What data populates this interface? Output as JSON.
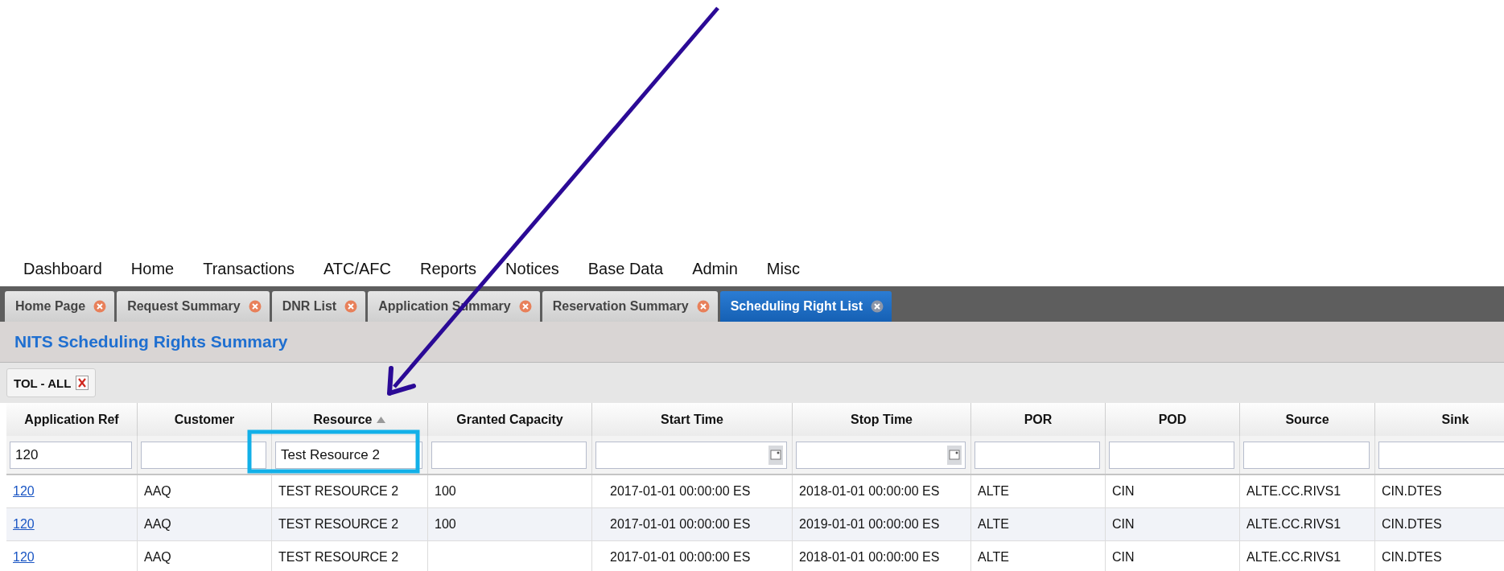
{
  "menu": [
    "Dashboard",
    "Home",
    "Transactions",
    "ATC/AFC",
    "Reports",
    "Notices",
    "Base Data",
    "Admin",
    "Misc"
  ],
  "tabs": [
    {
      "label": "Home Page",
      "selected": false
    },
    {
      "label": "Request Summary",
      "selected": false
    },
    {
      "label": "DNR List",
      "selected": false
    },
    {
      "label": "Application Summary",
      "selected": false
    },
    {
      "label": "Reservation Summary",
      "selected": false
    },
    {
      "label": "Scheduling Right List",
      "selected": true
    }
  ],
  "page_title": "NITS Scheduling Rights Summary",
  "filter_chip": {
    "label": "TOL - ALL"
  },
  "table": {
    "columns": [
      {
        "label": "Application Ref",
        "sorted": false
      },
      {
        "label": "Customer",
        "sorted": false
      },
      {
        "label": "Resource",
        "sorted": true
      },
      {
        "label": "Granted Capacity",
        "sorted": false
      },
      {
        "label": "Start Time",
        "sorted": false
      },
      {
        "label": "Stop Time",
        "sorted": false
      },
      {
        "label": "POR",
        "sorted": false
      },
      {
        "label": "POD",
        "sorted": false
      },
      {
        "label": "Source",
        "sorted": false
      },
      {
        "label": "Sink",
        "sorted": false
      }
    ],
    "filters": [
      {
        "kind": "text",
        "value": "120"
      },
      {
        "kind": "text"
      },
      {
        "kind": "text",
        "value": "Test Resource 2"
      },
      {
        "kind": "text"
      },
      {
        "kind": "date"
      },
      {
        "kind": "date"
      },
      {
        "kind": "text"
      },
      {
        "kind": "text"
      },
      {
        "kind": "text"
      },
      {
        "kind": "text"
      }
    ],
    "rows": [
      [
        "120",
        "AAQ",
        "TEST RESOURCE 2",
        "100",
        "2017-01-01 00:00:00 ES",
        "2018-01-01 00:00:00 ES",
        "ALTE",
        "CIN",
        "ALTE.CC.RIVS1",
        "CIN.DTES"
      ],
      [
        "120",
        "AAQ",
        "TEST RESOURCE 2",
        "100",
        "2017-01-01 00:00:00 ES",
        "2019-01-01 00:00:00 ES",
        "ALTE",
        "CIN",
        "ALTE.CC.RIVS1",
        "CIN.DTES"
      ],
      [
        "120",
        "AAQ",
        "TEST RESOURCE 2",
        "",
        "2017-01-01 00:00:00 ES",
        "2018-01-01 00:00:00 ES",
        "ALTE",
        "CIN",
        "ALTE.CC.RIVS1",
        "CIN.DTES"
      ]
    ]
  }
}
